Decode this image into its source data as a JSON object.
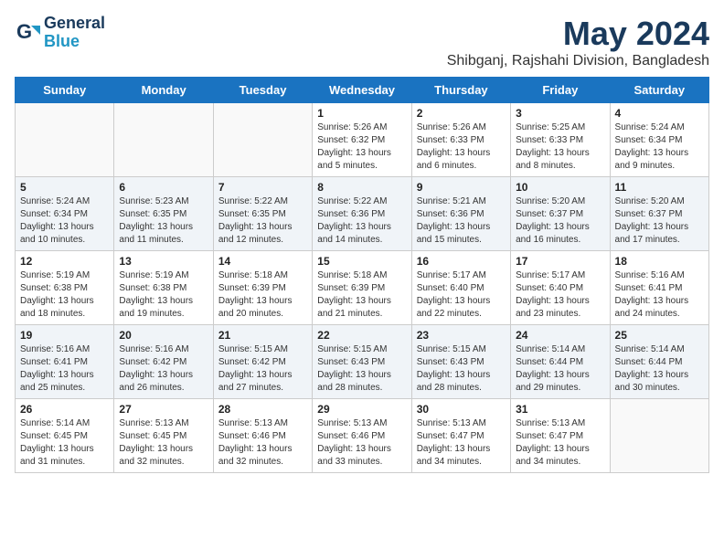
{
  "header": {
    "logo_line1": "General",
    "logo_line2": "Blue",
    "title": "May 2024",
    "subtitle": "Shibganj, Rajshahi Division, Bangladesh"
  },
  "weekdays": [
    "Sunday",
    "Monday",
    "Tuesday",
    "Wednesday",
    "Thursday",
    "Friday",
    "Saturday"
  ],
  "weeks": [
    [
      {
        "day": "",
        "info": ""
      },
      {
        "day": "",
        "info": ""
      },
      {
        "day": "",
        "info": ""
      },
      {
        "day": "1",
        "info": "Sunrise: 5:26 AM\nSunset: 6:32 PM\nDaylight: 13 hours\nand 5 minutes."
      },
      {
        "day": "2",
        "info": "Sunrise: 5:26 AM\nSunset: 6:33 PM\nDaylight: 13 hours\nand 6 minutes."
      },
      {
        "day": "3",
        "info": "Sunrise: 5:25 AM\nSunset: 6:33 PM\nDaylight: 13 hours\nand 8 minutes."
      },
      {
        "day": "4",
        "info": "Sunrise: 5:24 AM\nSunset: 6:34 PM\nDaylight: 13 hours\nand 9 minutes."
      }
    ],
    [
      {
        "day": "5",
        "info": "Sunrise: 5:24 AM\nSunset: 6:34 PM\nDaylight: 13 hours\nand 10 minutes."
      },
      {
        "day": "6",
        "info": "Sunrise: 5:23 AM\nSunset: 6:35 PM\nDaylight: 13 hours\nand 11 minutes."
      },
      {
        "day": "7",
        "info": "Sunrise: 5:22 AM\nSunset: 6:35 PM\nDaylight: 13 hours\nand 12 minutes."
      },
      {
        "day": "8",
        "info": "Sunrise: 5:22 AM\nSunset: 6:36 PM\nDaylight: 13 hours\nand 14 minutes."
      },
      {
        "day": "9",
        "info": "Sunrise: 5:21 AM\nSunset: 6:36 PM\nDaylight: 13 hours\nand 15 minutes."
      },
      {
        "day": "10",
        "info": "Sunrise: 5:20 AM\nSunset: 6:37 PM\nDaylight: 13 hours\nand 16 minutes."
      },
      {
        "day": "11",
        "info": "Sunrise: 5:20 AM\nSunset: 6:37 PM\nDaylight: 13 hours\nand 17 minutes."
      }
    ],
    [
      {
        "day": "12",
        "info": "Sunrise: 5:19 AM\nSunset: 6:38 PM\nDaylight: 13 hours\nand 18 minutes."
      },
      {
        "day": "13",
        "info": "Sunrise: 5:19 AM\nSunset: 6:38 PM\nDaylight: 13 hours\nand 19 minutes."
      },
      {
        "day": "14",
        "info": "Sunrise: 5:18 AM\nSunset: 6:39 PM\nDaylight: 13 hours\nand 20 minutes."
      },
      {
        "day": "15",
        "info": "Sunrise: 5:18 AM\nSunset: 6:39 PM\nDaylight: 13 hours\nand 21 minutes."
      },
      {
        "day": "16",
        "info": "Sunrise: 5:17 AM\nSunset: 6:40 PM\nDaylight: 13 hours\nand 22 minutes."
      },
      {
        "day": "17",
        "info": "Sunrise: 5:17 AM\nSunset: 6:40 PM\nDaylight: 13 hours\nand 23 minutes."
      },
      {
        "day": "18",
        "info": "Sunrise: 5:16 AM\nSunset: 6:41 PM\nDaylight: 13 hours\nand 24 minutes."
      }
    ],
    [
      {
        "day": "19",
        "info": "Sunrise: 5:16 AM\nSunset: 6:41 PM\nDaylight: 13 hours\nand 25 minutes."
      },
      {
        "day": "20",
        "info": "Sunrise: 5:16 AM\nSunset: 6:42 PM\nDaylight: 13 hours\nand 26 minutes."
      },
      {
        "day": "21",
        "info": "Sunrise: 5:15 AM\nSunset: 6:42 PM\nDaylight: 13 hours\nand 27 minutes."
      },
      {
        "day": "22",
        "info": "Sunrise: 5:15 AM\nSunset: 6:43 PM\nDaylight: 13 hours\nand 28 minutes."
      },
      {
        "day": "23",
        "info": "Sunrise: 5:15 AM\nSunset: 6:43 PM\nDaylight: 13 hours\nand 28 minutes."
      },
      {
        "day": "24",
        "info": "Sunrise: 5:14 AM\nSunset: 6:44 PM\nDaylight: 13 hours\nand 29 minutes."
      },
      {
        "day": "25",
        "info": "Sunrise: 5:14 AM\nSunset: 6:44 PM\nDaylight: 13 hours\nand 30 minutes."
      }
    ],
    [
      {
        "day": "26",
        "info": "Sunrise: 5:14 AM\nSunset: 6:45 PM\nDaylight: 13 hours\nand 31 minutes."
      },
      {
        "day": "27",
        "info": "Sunrise: 5:13 AM\nSunset: 6:45 PM\nDaylight: 13 hours\nand 32 minutes."
      },
      {
        "day": "28",
        "info": "Sunrise: 5:13 AM\nSunset: 6:46 PM\nDaylight: 13 hours\nand 32 minutes."
      },
      {
        "day": "29",
        "info": "Sunrise: 5:13 AM\nSunset: 6:46 PM\nDaylight: 13 hours\nand 33 minutes."
      },
      {
        "day": "30",
        "info": "Sunrise: 5:13 AM\nSunset: 6:47 PM\nDaylight: 13 hours\nand 34 minutes."
      },
      {
        "day": "31",
        "info": "Sunrise: 5:13 AM\nSunset: 6:47 PM\nDaylight: 13 hours\nand 34 minutes."
      },
      {
        "day": "",
        "info": ""
      }
    ]
  ]
}
